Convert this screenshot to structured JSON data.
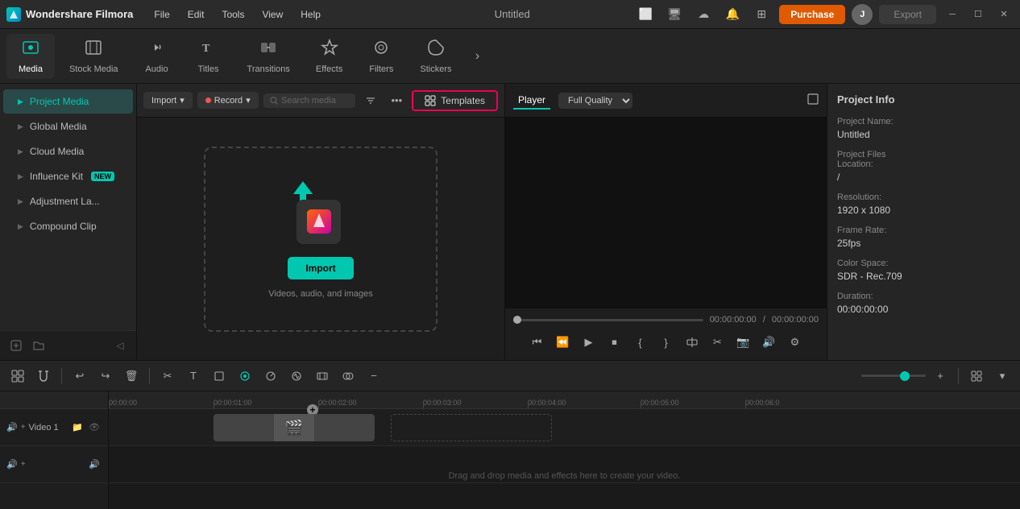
{
  "app": {
    "name": "Wondershare Filmora",
    "title": "Untitled"
  },
  "titlebar": {
    "menus": [
      "File",
      "Edit",
      "Tools",
      "View",
      "Help"
    ],
    "purchase_label": "Purchase",
    "export_label": "Export"
  },
  "toolbar": {
    "items": [
      {
        "id": "media",
        "label": "Media",
        "icon": "▣",
        "active": true
      },
      {
        "id": "stock-media",
        "label": "Stock Media",
        "icon": "🎬"
      },
      {
        "id": "audio",
        "label": "Audio",
        "icon": "♪"
      },
      {
        "id": "titles",
        "label": "Titles",
        "icon": "T"
      },
      {
        "id": "transitions",
        "label": "Transitions",
        "icon": "⇄"
      },
      {
        "id": "effects",
        "label": "Effects",
        "icon": "✦"
      },
      {
        "id": "filters",
        "label": "Filters",
        "icon": "◈"
      },
      {
        "id": "stickers",
        "label": "Stickers",
        "icon": "★"
      }
    ]
  },
  "sidebar": {
    "items": [
      {
        "id": "project-media",
        "label": "Project Media",
        "active": true
      },
      {
        "id": "global-media",
        "label": "Global Media",
        "active": false
      },
      {
        "id": "cloud-media",
        "label": "Cloud Media",
        "active": false
      },
      {
        "id": "influence-kit",
        "label": "Influence Kit",
        "active": false,
        "badge": "NEW"
      },
      {
        "id": "adjustment-layers",
        "label": "Adjustment La...",
        "active": false
      },
      {
        "id": "compound-clip",
        "label": "Compound Clip",
        "active": false
      }
    ],
    "bottom_icons": [
      "add-folder",
      "new-folder"
    ]
  },
  "content_header": {
    "import_label": "Import",
    "record_label": "Record",
    "search_placeholder": "Search media",
    "templates_label": "Templates"
  },
  "import_zone": {
    "button_label": "Import",
    "description": "Videos, audio, and images"
  },
  "player": {
    "tabs": [
      "Player"
    ],
    "quality": "Full Quality",
    "time_current": "00:00:00:00",
    "time_total": "00:00:00:00"
  },
  "project_info": {
    "title": "Project Info",
    "fields": [
      {
        "label": "Project Name:",
        "value": "Untitled"
      },
      {
        "label": "Project Files\nLocation:",
        "value": "/"
      },
      {
        "label": "Resolution:",
        "value": "1920 x 1080"
      },
      {
        "label": "Frame Rate:",
        "value": "25fps"
      },
      {
        "label": "Color Space:",
        "value": "SDR - Rec.709"
      },
      {
        "label": "Duration:",
        "value": "00:00:00:00"
      }
    ]
  },
  "timeline": {
    "ruler_marks": [
      "00:00:00",
      "00:00:01:00",
      "00:00:02:00",
      "00:00:03:00",
      "00:00:04:00",
      "00:00:05:00",
      "00:00:06:0"
    ],
    "ruler_positions": [
      0,
      130,
      260,
      390,
      520,
      660,
      790
    ],
    "tracks": [
      {
        "id": "video1",
        "label": "Video 1",
        "type": "video",
        "icons": [
          "speaker",
          "eye"
        ]
      },
      {
        "id": "audio1",
        "label": "",
        "type": "audio",
        "icons": [
          "speaker"
        ]
      }
    ],
    "drag_hint": "Drag and drop media and effects here to create your video."
  }
}
